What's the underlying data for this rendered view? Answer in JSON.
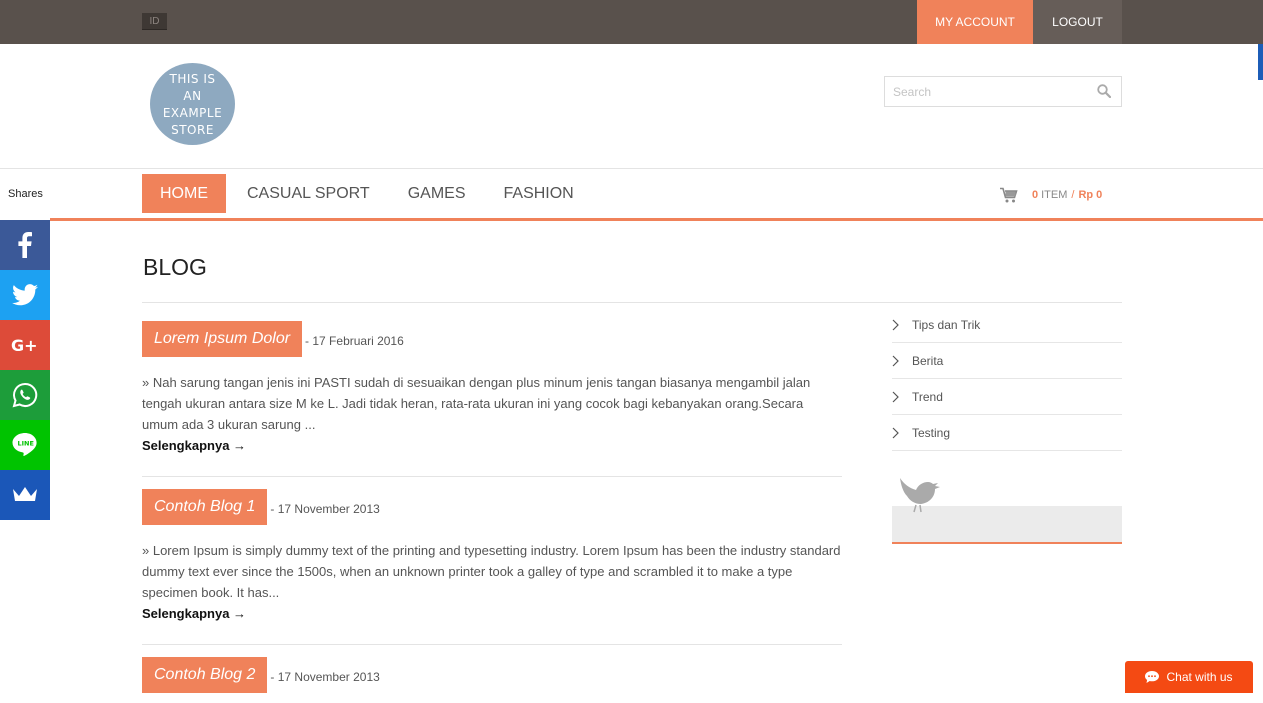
{
  "topbar": {
    "lang": "ID",
    "my_account": "MY ACCOUNT",
    "logout": "LOGOUT"
  },
  "logo": {
    "line1": "THIS IS",
    "line2": "AN",
    "line3": "EXAMPLE",
    "line4": "STORE"
  },
  "search": {
    "placeholder": "Search"
  },
  "nav": {
    "items": [
      "HOME",
      "CASUAL SPORT",
      "GAMES",
      "FASHION"
    ]
  },
  "cart": {
    "count": "0",
    "item_label": "ITEM",
    "currency": "Rp",
    "total": "0"
  },
  "share": {
    "label": "Shares",
    "buttons": [
      "facebook",
      "twitter",
      "google-plus",
      "whatsapp",
      "line",
      "sumome"
    ]
  },
  "page": {
    "title": "BLOG"
  },
  "posts": [
    {
      "title": "Lorem Ipsum Dolor",
      "date": "- 17 Februari 2016",
      "excerpt": "» Nah sarung tangan jenis ini PASTI sudah di sesuaikan dengan plus minum jenis tangan biasanya mengambil jalan tengah ukuran antara size M ke L. Jadi tidak heran, rata-rata ukuran ini yang cocok bagi kebanyakan orang.Secara umum ada 3 ukuran sarung ...",
      "more": "Selengkapnya →"
    },
    {
      "title": "Contoh Blog 1",
      "date": "- 17 November 2013",
      "excerpt": "» Lorem Ipsum is simply dummy text of the printing and typesetting industry. Lorem Ipsum has been the industry standard dummy text ever since the 1500s, when an unknown printer took a galley of type and scrambled it to make a type specimen book. It has...",
      "more": "Selengkapnya →"
    },
    {
      "title": "Contoh Blog 2",
      "date": "- 17 November 2013"
    }
  ],
  "categories": [
    "Tips dan Trik",
    "Berita",
    "Trend",
    "Testing"
  ],
  "chat": {
    "label": "Chat with us"
  },
  "colors": {
    "accent": "#f0825a",
    "topbar": "#59514c",
    "chat": "#f44a13"
  }
}
